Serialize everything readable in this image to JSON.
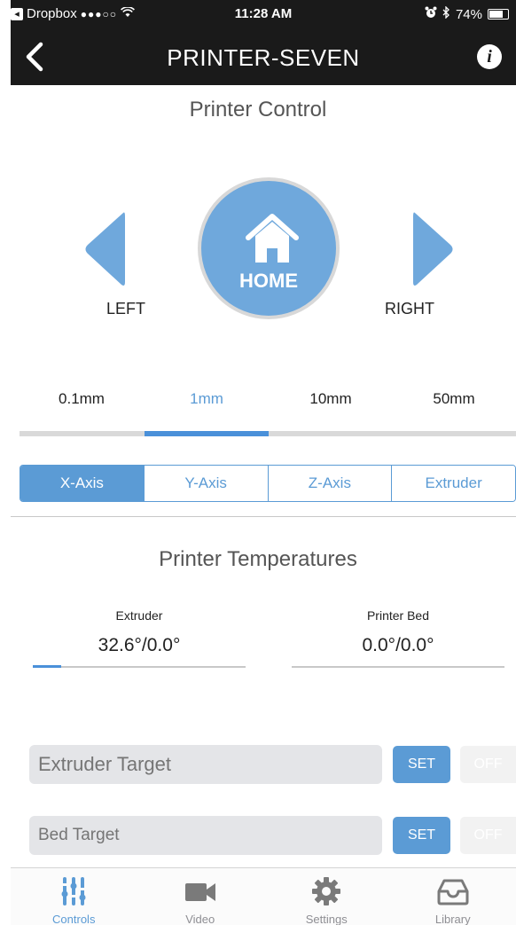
{
  "status_bar": {
    "back_app": "Dropbox",
    "signal": "●●●○○",
    "time": "11:28 AM",
    "battery": "74%",
    "battery_level": 0.74
  },
  "nav": {
    "title": "PRINTER-SEVEN",
    "info_glyph": "i"
  },
  "printer_control": {
    "title": "Printer Control",
    "left_label": "LEFT",
    "home_label": "HOME",
    "right_label": "RIGHT"
  },
  "steps": {
    "options": [
      "0.1mm",
      "1mm",
      "10mm",
      "50mm"
    ],
    "selected": "1mm"
  },
  "axes": {
    "options": [
      "X-Axis",
      "Y-Axis",
      "Z-Axis",
      "Extruder"
    ],
    "selected": "X-Axis"
  },
  "temperatures": {
    "title": "Printer Temperatures",
    "extruder": {
      "label": "Extruder",
      "value": "32.6°/0.0°"
    },
    "bed": {
      "label": "Printer Bed",
      "value": "0.0°/0.0°"
    }
  },
  "targets": {
    "extruder_placeholder": "Extruder Target",
    "bed_placeholder": "Bed Target",
    "set_label": "SET",
    "off_label": "OFF"
  },
  "tabs": [
    {
      "label": "Controls",
      "icon": "sliders-icon",
      "active": true
    },
    {
      "label": "Video",
      "icon": "video-camera-icon",
      "active": false
    },
    {
      "label": "Settings",
      "icon": "gear-icon",
      "active": false
    },
    {
      "label": "Library",
      "icon": "inbox-tray-icon",
      "active": false
    }
  ],
  "colors": {
    "accent": "#5b9bd5",
    "bar": "#1a1a1a"
  }
}
